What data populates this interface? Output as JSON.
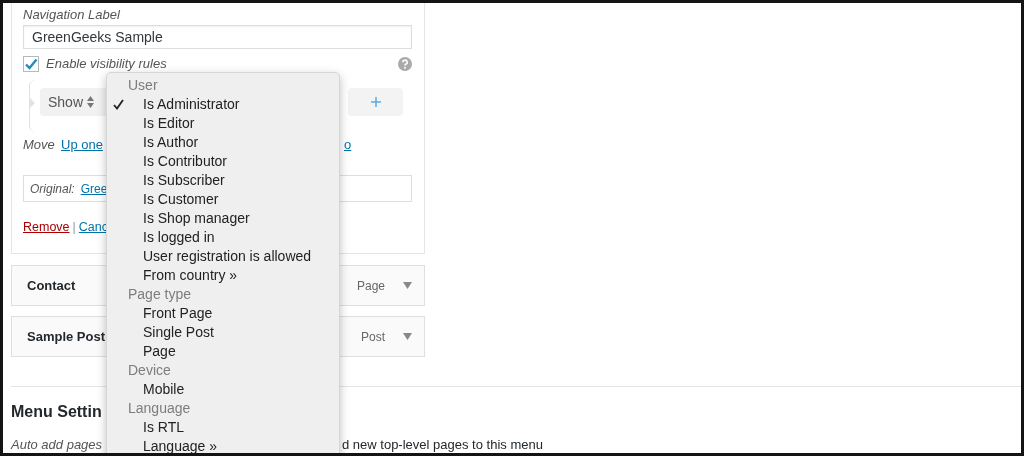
{
  "item_settings": {
    "navigation_label": {
      "label": "Navigation Label",
      "value": "GreenGeeks Sample"
    },
    "visibility": {
      "label": "Enable visibility rules",
      "checked": true
    },
    "rule": {
      "action": "Show"
    },
    "move": {
      "label": "Move",
      "links": [
        "Up one",
        "o"
      ]
    },
    "original": {
      "label": "Original:",
      "link": "Gree"
    },
    "actions": [
      {
        "label": "Remove",
        "kind": "delete"
      },
      {
        "label": "|",
        "kind": "separator"
      },
      {
        "label": "Canc",
        "kind": "link"
      }
    ]
  },
  "menu_items": [
    {
      "title": "Contact",
      "type": "Page"
    },
    {
      "title": "Sample Post",
      "type": "Post"
    }
  ],
  "menu_settings": {
    "heading": "Menu Settin",
    "auto_add": {
      "label": "Auto add pages",
      "description": "d new top-level pages to this menu"
    }
  },
  "dropdown": {
    "groups": [
      {
        "label": "User",
        "options": [
          {
            "label": "Is Administrator",
            "selected": true
          },
          {
            "label": "Is Editor",
            "selected": false
          },
          {
            "label": "Is Author",
            "selected": false
          },
          {
            "label": "Is Contributor",
            "selected": false
          },
          {
            "label": "Is Subscriber",
            "selected": false
          },
          {
            "label": "Is Customer",
            "selected": false
          },
          {
            "label": "Is Shop manager",
            "selected": false
          },
          {
            "label": "Is logged in",
            "selected": false
          },
          {
            "label": "User registration is allowed",
            "selected": false
          },
          {
            "label": "From country »",
            "selected": false
          }
        ]
      },
      {
        "label": "Page type",
        "options": [
          {
            "label": "Front Page",
            "selected": false
          },
          {
            "label": "Single Post",
            "selected": false
          },
          {
            "label": "Page",
            "selected": false
          }
        ]
      },
      {
        "label": "Device",
        "options": [
          {
            "label": "Mobile",
            "selected": false
          }
        ]
      },
      {
        "label": "Language",
        "options": [
          {
            "label": "Is RTL",
            "selected": false
          },
          {
            "label": "Language »",
            "selected": false
          }
        ]
      }
    ]
  }
}
